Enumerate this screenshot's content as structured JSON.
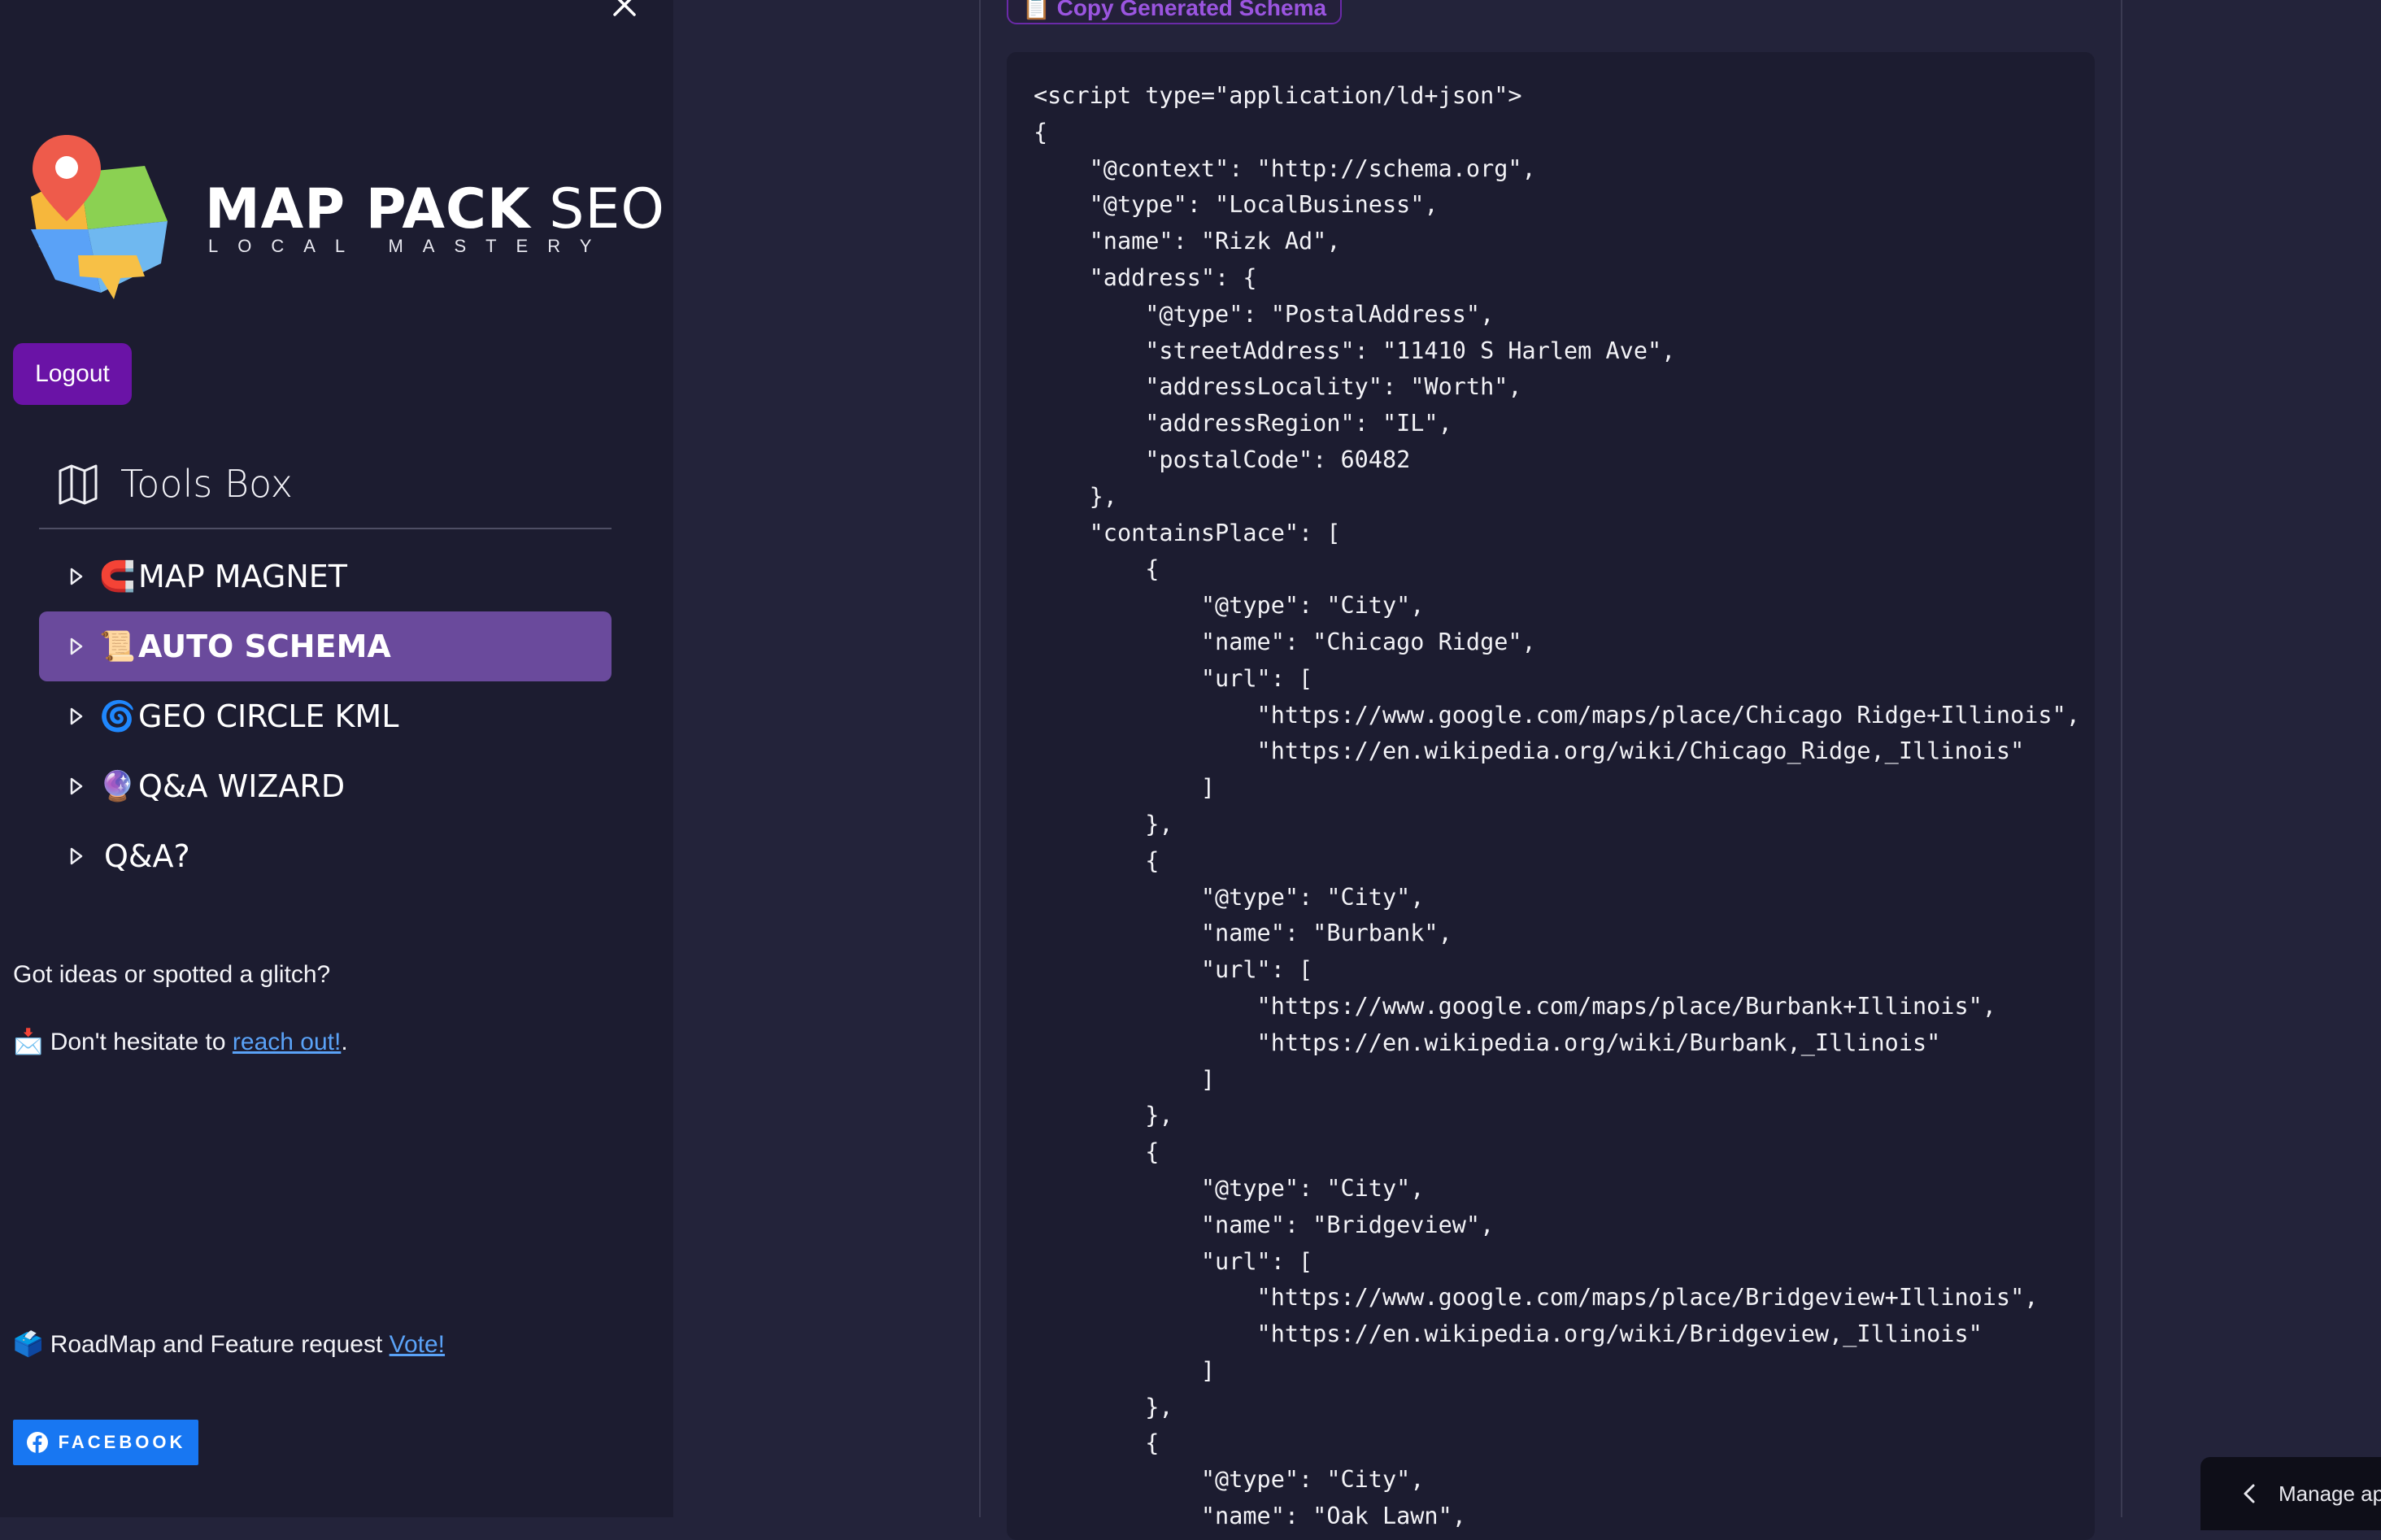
{
  "sidebar": {
    "brand": {
      "title_bold": "MAP PACK",
      "title_light": "SEO",
      "tagline": "LOCAL MASTERY"
    },
    "logout_label": "Logout",
    "tools_box_label": "Tools Box",
    "nav_items": [
      {
        "emoji": "🧲",
        "label": "MAP MAGNET",
        "active": false
      },
      {
        "emoji": "📜",
        "label": "AUTO SCHEMA",
        "active": true
      },
      {
        "emoji": "🌀",
        "label": "GEO CIRCLE KML",
        "active": false
      },
      {
        "emoji": "🔮",
        "label": "Q&A WIZARD",
        "active": false
      },
      {
        "emoji": "",
        "label": "Q&A?",
        "active": false
      }
    ],
    "feedback_question": "Got ideas or spotted a glitch?",
    "feedback_prefix": "📩 Don't hesitate to ",
    "feedback_link": "reach out!",
    "feedback_suffix": ".",
    "roadmap_prefix": "🗳️ RoadMap and Feature request ",
    "roadmap_link": "Vote!",
    "facebook_label": "FACEBOOK"
  },
  "main": {
    "top_button_label": "📋 Copy Generated Schema",
    "code_lines": [
      "<script type=\"application/ld+json\">",
      "{",
      "    \"@context\": \"http://schema.org\",",
      "    \"@type\": \"LocalBusiness\",",
      "    \"name\": \"Rizk Ad\",",
      "    \"address\": {",
      "        \"@type\": \"PostalAddress\",",
      "        \"streetAddress\": \"11410 S Harlem Ave\",",
      "        \"addressLocality\": \"Worth\",",
      "        \"addressRegion\": \"IL\",",
      "        \"postalCode\": 60482",
      "    },",
      "    \"containsPlace\": [",
      "        {",
      "            \"@type\": \"City\",",
      "            \"name\": \"Chicago Ridge\",",
      "            \"url\": [",
      "                \"https://www.google.com/maps/place/Chicago Ridge+Illinois\",",
      "                \"https://en.wikipedia.org/wiki/Chicago_Ridge,_Illinois\"",
      "            ]",
      "        },",
      "        {",
      "            \"@type\": \"City\",",
      "            \"name\": \"Burbank\",",
      "            \"url\": [",
      "                \"https://www.google.com/maps/place/Burbank+Illinois\",",
      "                \"https://en.wikipedia.org/wiki/Burbank,_Illinois\"",
      "            ]",
      "        },",
      "        {",
      "            \"@type\": \"City\",",
      "            \"name\": \"Bridgeview\",",
      "            \"url\": [",
      "                \"https://www.google.com/maps/place/Bridgeview+Illinois\",",
      "                \"https://en.wikipedia.org/wiki/Bridgeview,_Illinois\"",
      "            ]",
      "        },",
      "        {",
      "            \"@type\": \"City\",",
      "            \"name\": \"Oak Lawn\","
    ]
  },
  "manage_app_label": "Manage app",
  "colors": {
    "sidebar_bg": "#1c1c30",
    "main_bg": "#23233a",
    "active_item": "#6a4a9c",
    "logout_purple": "#6a13a6",
    "link_blue": "#5aa2f7",
    "facebook_blue": "#1877f2"
  },
  "icons": [
    "close-icon",
    "map-pin-logo",
    "map-icon",
    "caret-right-icon",
    "facebook-icon",
    "chevron-left-icon"
  ]
}
